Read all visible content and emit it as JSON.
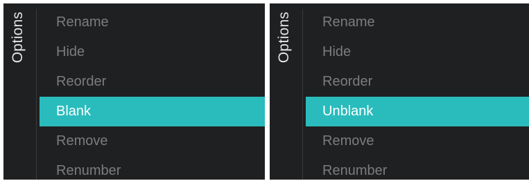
{
  "panels": [
    {
      "title": "Options",
      "selected_index": 3,
      "items": [
        {
          "label": "Rename"
        },
        {
          "label": "Hide"
        },
        {
          "label": "Reorder"
        },
        {
          "label": "Blank"
        },
        {
          "label": "Remove"
        },
        {
          "label": "Renumber"
        }
      ]
    },
    {
      "title": "Options",
      "selected_index": 3,
      "items": [
        {
          "label": "Rename"
        },
        {
          "label": "Hide"
        },
        {
          "label": "Reorder"
        },
        {
          "label": "Unblank"
        },
        {
          "label": "Remove"
        },
        {
          "label": "Renumber"
        }
      ]
    }
  ],
  "colors": {
    "background": "#1f2021",
    "highlight": "#2abcbc",
    "item_text": "#7b7c7e",
    "selected_text": "#ffffff",
    "title_text": "#e6e6e6"
  }
}
